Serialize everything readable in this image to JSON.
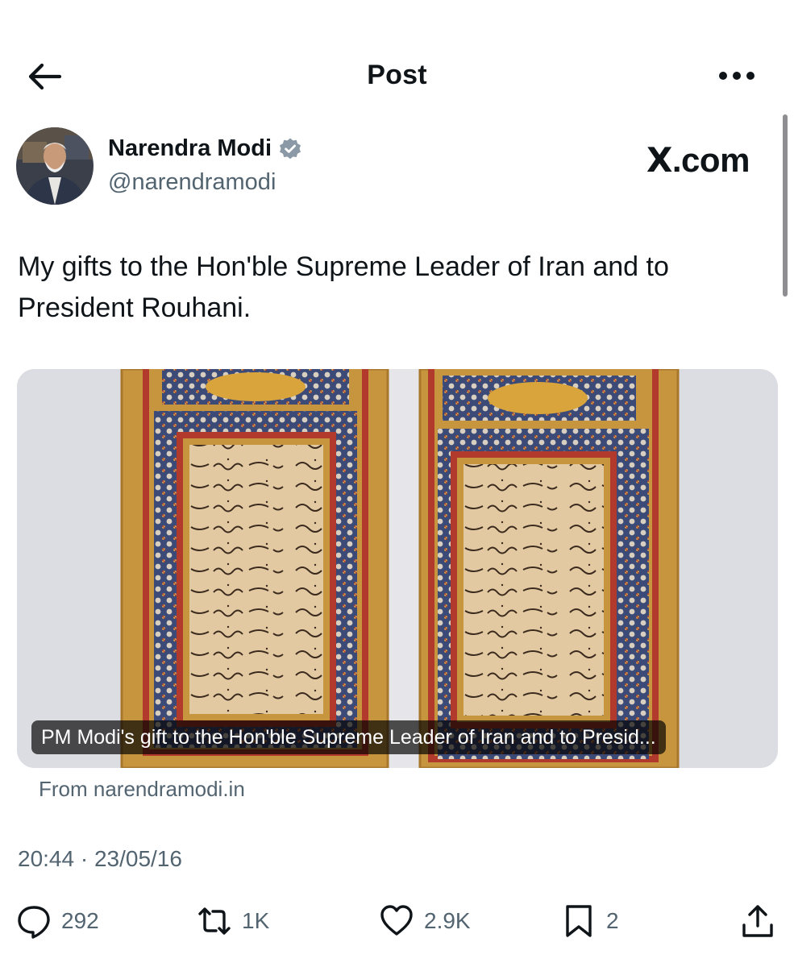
{
  "header": {
    "title": "Post",
    "back_icon": "arrow-left-icon",
    "more_icon": "more-horizontal-icon"
  },
  "author": {
    "name": "Narendra Modi",
    "handle": "@narendramodi",
    "verified_color": "#1d9bf0"
  },
  "brand": {
    "letter": "X",
    "suffix": ".com"
  },
  "post": {
    "text": "My gifts to the Hon'ble Supreme Leader of Iran and to President Rouhani."
  },
  "link_card": {
    "caption": "PM Modi's gift to the Hon'ble Supreme Leader of Iran and to Presid...",
    "source": "From narendramodi.in"
  },
  "timestamp": "20:44 · 23/05/16",
  "actions": {
    "reply_count": "292",
    "repost_count": "1K",
    "like_count": "2.9K",
    "bookmark_count": "2"
  },
  "colors": {
    "text_primary": "#0f1419",
    "text_secondary": "#536471"
  }
}
